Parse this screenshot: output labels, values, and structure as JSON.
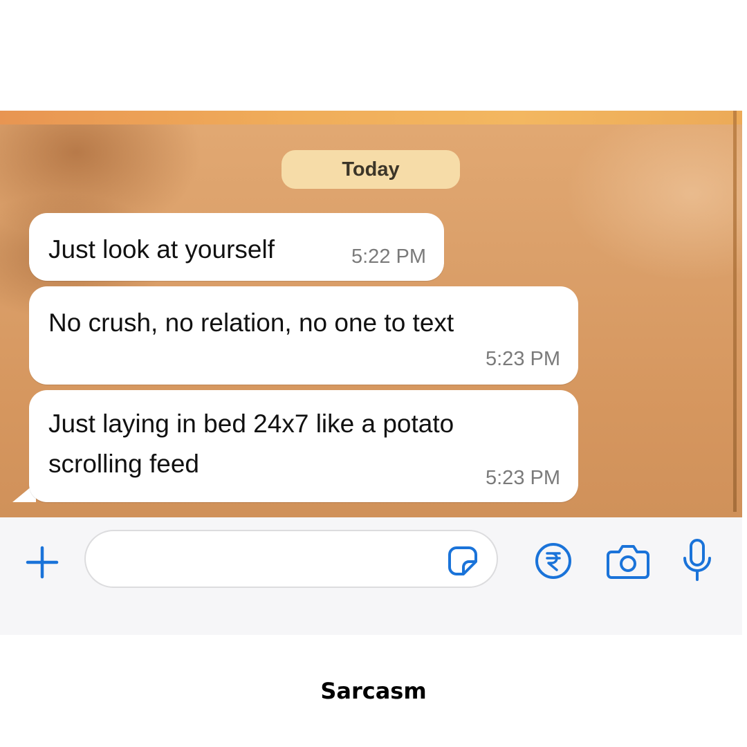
{
  "chat": {
    "date_separator": "Today",
    "messages": [
      {
        "text": "Just look at yourself",
        "time": "5:22 PM"
      },
      {
        "text": "No crush, no relation, no one to text",
        "time": "5:23 PM"
      },
      {
        "lines": [
          "Just laying in bed 24x7 like a potato",
          "scrolling feed"
        ],
        "time": "5:23 PM"
      }
    ]
  },
  "input_bar": {
    "message_value": "",
    "icons": [
      "plus-icon",
      "sticker-icon",
      "rupee-payment-icon",
      "camera-icon",
      "microphone-icon"
    ],
    "accent_color": "#1a73d9"
  },
  "caption": "Sarcasm"
}
